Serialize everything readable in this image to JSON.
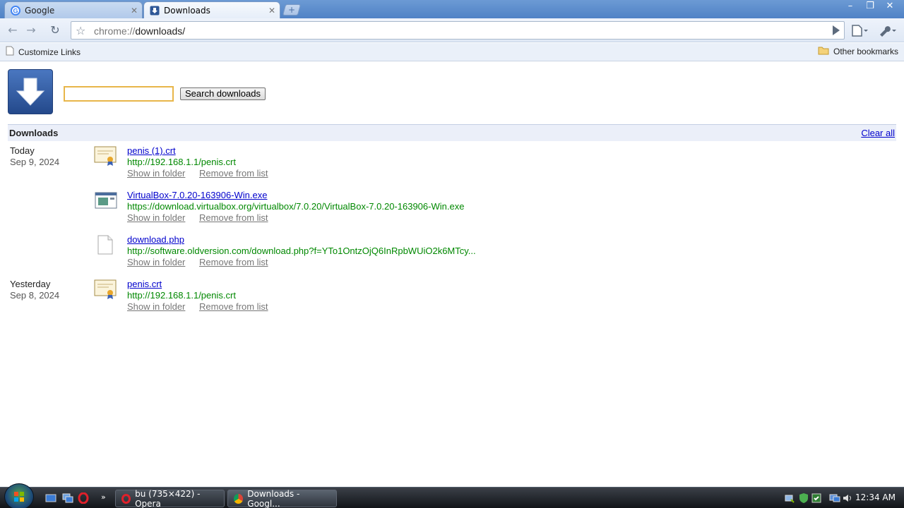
{
  "tabs": [
    {
      "label": "Google",
      "favicon": "google-icon",
      "active": false
    },
    {
      "label": "Downloads",
      "favicon": "downloads-icon",
      "active": true
    }
  ],
  "window_controls": {
    "minimize": "–",
    "maximize": "❐",
    "close": "✕"
  },
  "toolbar": {
    "url_scheme": "chrome://",
    "url_host": "downloads/"
  },
  "bookmarks": {
    "left": "Customize Links",
    "right": "Other bookmarks"
  },
  "search": {
    "value": "",
    "button_label": "Search downloads"
  },
  "downloads_header": {
    "title": "Downloads",
    "clear_all": "Clear all"
  },
  "groups": [
    {
      "label": "Today",
      "date": "Sep 9, 2024"
    },
    {
      "label": "Yesterday",
      "date": "Sep 8, 2024"
    }
  ],
  "items": [
    {
      "name": "penis (1).crt",
      "url": "http://192.168.1.1/penis.crt",
      "icon": "certificate-icon",
      "show": "Show in folder",
      "remove": "Remove from list"
    },
    {
      "name": "VirtualBox-7.0.20-163906-Win.exe",
      "url": "https://download.virtualbox.org/virtualbox/7.0.20/VirtualBox-7.0.20-163906-Win.exe",
      "icon": "installer-icon",
      "show": "Show in folder",
      "remove": "Remove from list"
    },
    {
      "name": "download.php",
      "url": "http://software.oldversion.com/download.php?f=YTo1OntzOjQ6InRpbWUiO2k6MTcy...",
      "icon": "blank-file-icon",
      "show": "Show in folder",
      "remove": "Remove from list"
    },
    {
      "name": "penis.crt",
      "url": "http://192.168.1.1/penis.crt",
      "icon": "certificate-icon",
      "show": "Show in folder",
      "remove": "Remove from list"
    }
  ],
  "taskbar": {
    "buttons": [
      {
        "label": "bu (735×422) - Opera"
      },
      {
        "label": "Downloads - Googl..."
      }
    ],
    "clock": "12:34 AM"
  }
}
